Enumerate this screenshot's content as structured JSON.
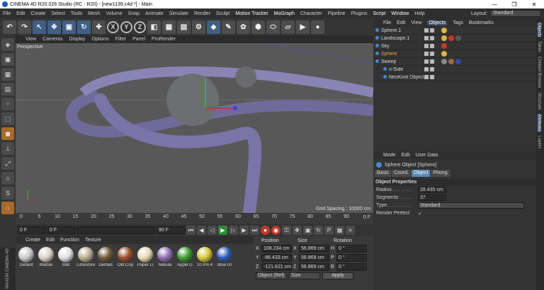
{
  "window": {
    "title": "CINEMA 4D R20.026 Studio (RC - R20) - [new1139.c4d *] - Main",
    "controls": [
      "—",
      "❐",
      "✕"
    ]
  },
  "menu": [
    "File",
    "Edit",
    "Create",
    "Select",
    "Tools",
    "Mesh",
    "Volume",
    "Snap",
    "Animate",
    "Simulate",
    "Render",
    "Sculpt",
    "Motion Tracker",
    "MoGraph",
    "Character",
    "Pipeline",
    "Plugins",
    "Script",
    "Window",
    "Help"
  ],
  "layout": {
    "label": "Layout:",
    "value": "Standard"
  },
  "viewport": {
    "menu": [
      "View",
      "Cameras",
      "Display",
      "Options",
      "Filter",
      "Panel",
      "ProRender"
    ],
    "label": "Perspective",
    "grid": "Grid Spacing : 10000 cm"
  },
  "timeline": {
    "ticks": [
      "0",
      "5",
      "10",
      "15",
      "20",
      "25",
      "30",
      "35",
      "40",
      "45",
      "50",
      "55",
      "60",
      "65",
      "70",
      "75",
      "80",
      "85",
      "90"
    ],
    "end": "0 F"
  },
  "transport": {
    "start": "0 F",
    "cur": "0 F",
    "end": "90 F",
    "end2": "90 F"
  },
  "materials": {
    "menu": [
      "Create",
      "Edit",
      "Function",
      "Texture"
    ],
    "items": [
      {
        "name": "Default",
        "color": "#c8c8c8"
      },
      {
        "name": "Marble",
        "color": "#d8d0c4"
      },
      {
        "name": "Mat",
        "color": "#e0e0e0"
      },
      {
        "name": "Limestone",
        "color": "#b8ae96"
      },
      {
        "name": "Dented",
        "color": "#6f5a36"
      },
      {
        "name": "Old Cop",
        "color": "#9a4e2a"
      },
      {
        "name": "Paper Li",
        "color": "#e6d9b4"
      },
      {
        "name": "Nebula",
        "color": "#8e6fb3"
      },
      {
        "name": "Apple G",
        "color": "#3c9a2c"
      },
      {
        "name": "10 Pin 4",
        "color": "#d4c53a"
      },
      {
        "name": "Blue Gl",
        "color": "#2c58b4"
      }
    ]
  },
  "coords": {
    "headers": [
      "Position",
      "Size",
      "Rotation"
    ],
    "rows": [
      {
        "axis": "X",
        "pos": "108.234 cm",
        "size": "56.869 cm",
        "rot_axis": "H",
        "rot": "0 °"
      },
      {
        "axis": "Y",
        "pos": "-86.433 cm",
        "size": "56.869 cm",
        "rot_axis": "P",
        "rot": "0 °"
      },
      {
        "axis": "Z",
        "pos": "-121.621 cm",
        "size": "56.869 cm",
        "rot_axis": "B",
        "rot": "0 °"
      }
    ],
    "mode": "Object (Rel)",
    "size_mode": "Size",
    "apply": "Apply"
  },
  "objects": {
    "menu": [
      "File",
      "Edit",
      "View",
      "Objects",
      "Tags",
      "Bookmarks"
    ],
    "active_menu": "Objects",
    "items": [
      {
        "name": "Sphere.1",
        "color": "#d6d6d6",
        "tags": [
          "#d9b34a"
        ]
      },
      {
        "name": "Landscape.1",
        "color": "#d6d6d6",
        "tags": [
          "#d9b34a",
          "#c0392b",
          "#555"
        ]
      },
      {
        "name": "Sky",
        "color": "#d6d6d6",
        "tags": [
          "#c0392b"
        ]
      },
      {
        "name": "Sphere",
        "color": "#f2a03a",
        "tags": [
          "#d9b34a"
        ]
      },
      {
        "name": "Sweep",
        "color": "#d6d6d6",
        "tags": [
          "#888",
          "#9c6a4a",
          "#3a4aa0"
        ]
      },
      {
        "name": "n-Side",
        "color": "#d6d6d6",
        "tags": []
      },
      {
        "name": "NeoKnot Object",
        "color": "#d6d6d6",
        "tags": []
      }
    ]
  },
  "attributes": {
    "menu": [
      "Mode",
      "Edit",
      "User Data"
    ],
    "title": "Sphere Object [Sphere]",
    "tabs": [
      "Basic",
      "Coord.",
      "Object",
      "Phong"
    ],
    "active_tab": "Object",
    "section": "Object Properties",
    "props": [
      {
        "label": "Radius . . . . . . .",
        "value": "28.435 cm"
      },
      {
        "label": "Segments . . . . .",
        "value": "37"
      },
      {
        "label": "Type. . . . . . . . .",
        "value": "Standard"
      },
      {
        "label": "Render Perfect",
        "value": "✓"
      }
    ]
  },
  "rightstrip": [
    "Objects",
    "Takes",
    "Content Browser",
    "Structure",
    "Attributes",
    "Layers"
  ]
}
